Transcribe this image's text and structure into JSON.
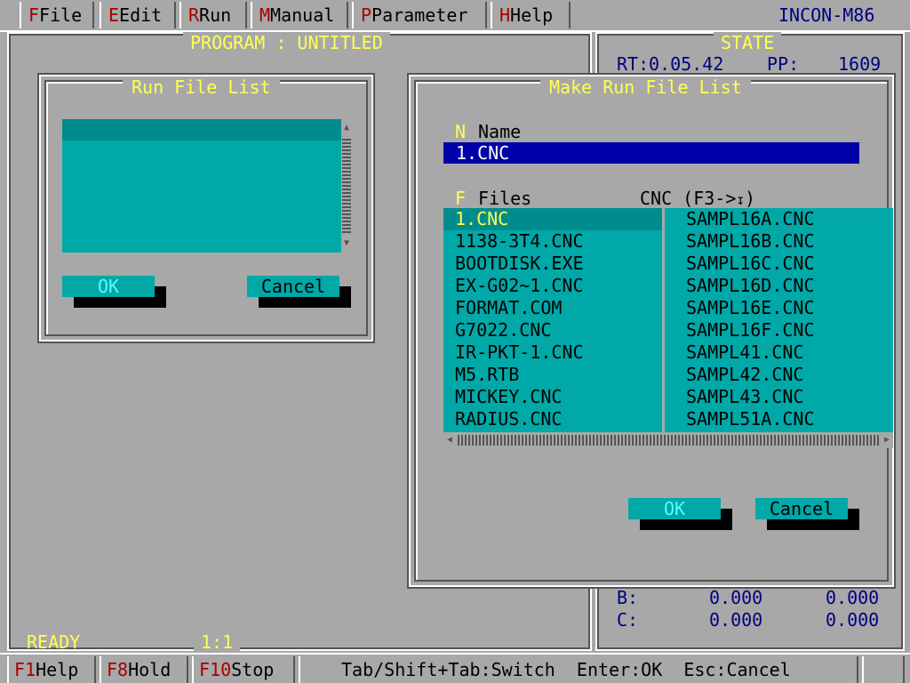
{
  "menubar": {
    "items": [
      {
        "hotkey": "F",
        "label": "File"
      },
      {
        "hotkey": "E",
        "label": "Edit"
      },
      {
        "hotkey": "R",
        "label": "Run"
      },
      {
        "hotkey": "M",
        "label": "Manual"
      },
      {
        "hotkey": "P",
        "label": "Parameter"
      },
      {
        "hotkey": "H",
        "label": "Help"
      }
    ],
    "app_name": "INCON-M86"
  },
  "program_panel": {
    "title": "PROGRAM : UNTITLED",
    "status": "READY",
    "scale": "1:1"
  },
  "state_panel": {
    "title": "STATE",
    "rt_label": "RT:",
    "rt_value": "0.05.42",
    "pp_label": "PP:",
    "pp_value": "1609",
    "axes": [
      {
        "label": "B:",
        "v1": "0.000",
        "v2": "0.000"
      },
      {
        "label": "C:",
        "v1": "0.000",
        "v2": "0.000"
      }
    ]
  },
  "run_file_list_dialog": {
    "title": "Run File List",
    "ok_label": "OK",
    "cancel_label": "Cancel"
  },
  "make_run_file_list_dialog": {
    "title": "Make Run File List",
    "name_hotkey": "N",
    "name_label": "Name",
    "name_value": "1.CNC",
    "files_hotkey": "F",
    "files_label": "Files",
    "filter_label": "CNC (F3->",
    "filter_suffix": ")",
    "files_left": [
      "1.CNC",
      "1138-3T4.CNC",
      "BOOTDISK.EXE",
      "EX-G02~1.CNC",
      "FORMAT.COM",
      "G7022.CNC",
      "IR-PKT-1.CNC",
      "M5.RTB",
      "MICKEY.CNC",
      "RADIUS.CNC"
    ],
    "files_right": [
      "SAMPL16A.CNC",
      "SAMPL16B.CNC",
      "SAMPL16C.CNC",
      "SAMPL16D.CNC",
      "SAMPL16E.CNC",
      "SAMPL16F.CNC",
      "SAMPL41.CNC",
      "SAMPL42.CNC",
      "SAMPL43.CNC",
      "SAMPL51A.CNC"
    ],
    "ok_label": "OK",
    "cancel_label": "Cancel"
  },
  "bottombar": {
    "keys": [
      {
        "hotkey": "F1",
        "label": "Help"
      },
      {
        "hotkey": "F8",
        "label": "Hold"
      },
      {
        "hotkey": "F10",
        "label": "Stop"
      }
    ],
    "hint": "Tab/Shift+Tab:Switch  Enter:OK  Esc:Cancel"
  }
}
